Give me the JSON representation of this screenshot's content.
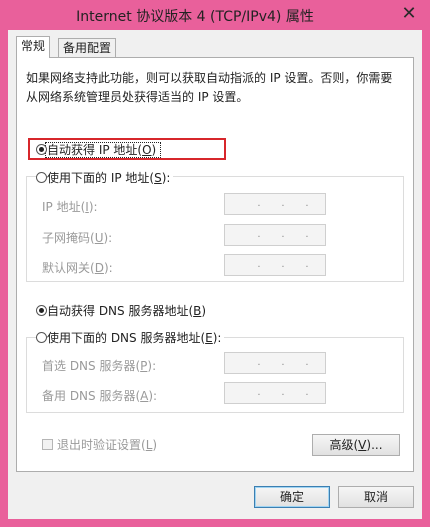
{
  "window": {
    "title": "Internet 协议版本 4 (TCP/IPv4) 属性",
    "close_glyph": "✕"
  },
  "tabs": [
    {
      "label": "常规",
      "active": true
    },
    {
      "label": "备用配置",
      "active": false
    }
  ],
  "description": "如果网络支持此功能，则可以获取自动指派的 IP 设置。否则，你需要从网络系统管理员处获得适当的 IP 设置。",
  "ip_section": {
    "auto_option": {
      "label": "自动获得 IP 地址(",
      "key": "O",
      "tail": ")",
      "selected": true
    },
    "manual_option": {
      "label": "使用下面的 IP 地址(",
      "key": "S",
      "tail": "):",
      "selected": false
    },
    "fields": [
      {
        "label": "IP 地址(",
        "key": "I",
        "tail": "):"
      },
      {
        "label": "子网掩码(",
        "key": "U",
        "tail": "):"
      },
      {
        "label": "默认网关(",
        "key": "D",
        "tail": "):"
      }
    ]
  },
  "dns_section": {
    "auto_option": {
      "label": "自动获得 DNS 服务器地址(",
      "key": "B",
      "tail": ")",
      "selected": true
    },
    "manual_option": {
      "label": "使用下面的 DNS 服务器地址(",
      "key": "E",
      "tail": "):",
      "selected": false
    },
    "fields": [
      {
        "label": "首选 DNS 服务器(",
        "key": "P",
        "tail": "):"
      },
      {
        "label": "备用 DNS 服务器(",
        "key": "A",
        "tail": "):"
      }
    ]
  },
  "validate_on_exit": {
    "label": "退出时验证设置(",
    "key": "L",
    "tail": ")",
    "checked": false
  },
  "buttons": {
    "advanced": {
      "label": "高级(",
      "key": "V",
      "tail": ")..."
    },
    "ok": "确定",
    "cancel": "取消"
  },
  "ip_dot": "."
}
